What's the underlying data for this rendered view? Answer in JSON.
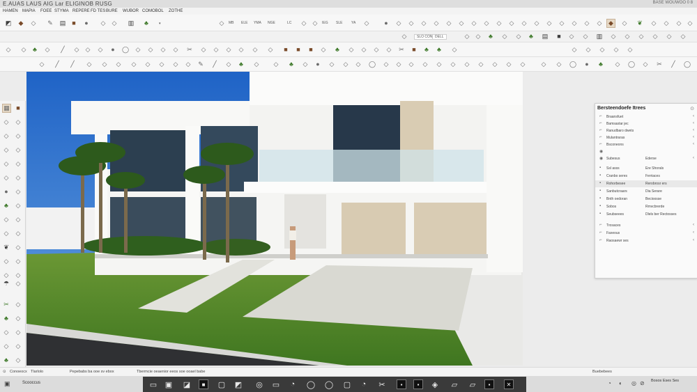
{
  "window": {
    "title": "E.AUAS LAUS AIG Lar ELIGINOB RUSG",
    "controls_text": "BASE   WOUWOO 0 8"
  },
  "menu": [
    "HAMEN",
    "MAPIA",
    "FOEE",
    "STYMA",
    "REPERE",
    "FD TES",
    "BURE",
    "WUBOR",
    "COMOBOL",
    "ZOTHE"
  ],
  "toolbar": {
    "inline_labels": [
      "MB",
      "ELE",
      "YMA",
      "NGE",
      "LC",
      "IEG",
      "SLE",
      "YA"
    ],
    "search_labels": [
      "SLO CONNS",
      "DELL"
    ]
  },
  "panel": {
    "title": "Bersteendoefe Itrees",
    "rows": [
      {
        "icon": "tick",
        "label": "Braansfuet",
        "value": "",
        "end": "chevron"
      },
      {
        "icon": "tick",
        "label": "Bamsastar jec",
        "value": "",
        "end": "chevron"
      },
      {
        "icon": "tick",
        "label": "Ranudbaro dwets",
        "value": "",
        "end": "chevron"
      },
      {
        "icon": "tick",
        "label": "Mulantraras",
        "value": "",
        "end": "chevron"
      },
      {
        "icon": "tick",
        "label": "Bsconeons",
        "value": "",
        "end": "chevron"
      },
      {
        "icon": "circle",
        "label": "",
        "value": "",
        "end": ""
      },
      {
        "icon": "circle",
        "label": "Subesus",
        "value": "Ederse",
        "end": "chevron"
      },
      {
        "icon": "dot",
        "label": "Ssl asss",
        "value": "Ere Shorals",
        "end": ""
      },
      {
        "icon": "dot",
        "label": "Cranbo seres",
        "value": "Ferriaces",
        "end": ""
      },
      {
        "icon": "dot",
        "label": "Rohorbesee",
        "value": "Rerobrosr ers",
        "end": ""
      },
      {
        "icon": "dot",
        "label": "Sanbutcraars",
        "value": "Dia Serare",
        "end": ""
      },
      {
        "icon": "dot",
        "label": "Bnth oedoran",
        "value": "Becioosse",
        "end": ""
      },
      {
        "icon": "dot",
        "label": "Sobos",
        "value": "Rmvcbrerde",
        "end": ""
      },
      {
        "icon": "dot",
        "label": "Seubseees",
        "value": "Dlels ber Rectosses",
        "end": ""
      },
      {
        "icon": "tick",
        "label": "Trosaces",
        "value": "",
        "end": "chevron"
      },
      {
        "icon": "tick",
        "label": "Faxeous",
        "value": "",
        "end": "chevron"
      },
      {
        "icon": "tick",
        "label": "Raosaewr ses",
        "value": "",
        "end": "chevron"
      }
    ]
  },
  "status": {
    "left_items": [
      "Conoeocx",
      "Tlarlolo",
      "Pepebabs ba ooe sv ebox",
      "Tbermcie oeaenior eeos soe ooael babe"
    ],
    "right_item": "Buebebees"
  },
  "taskbar": {
    "left_label": "Scooccus",
    "right_text": "Bosos Eses Ses"
  }
}
